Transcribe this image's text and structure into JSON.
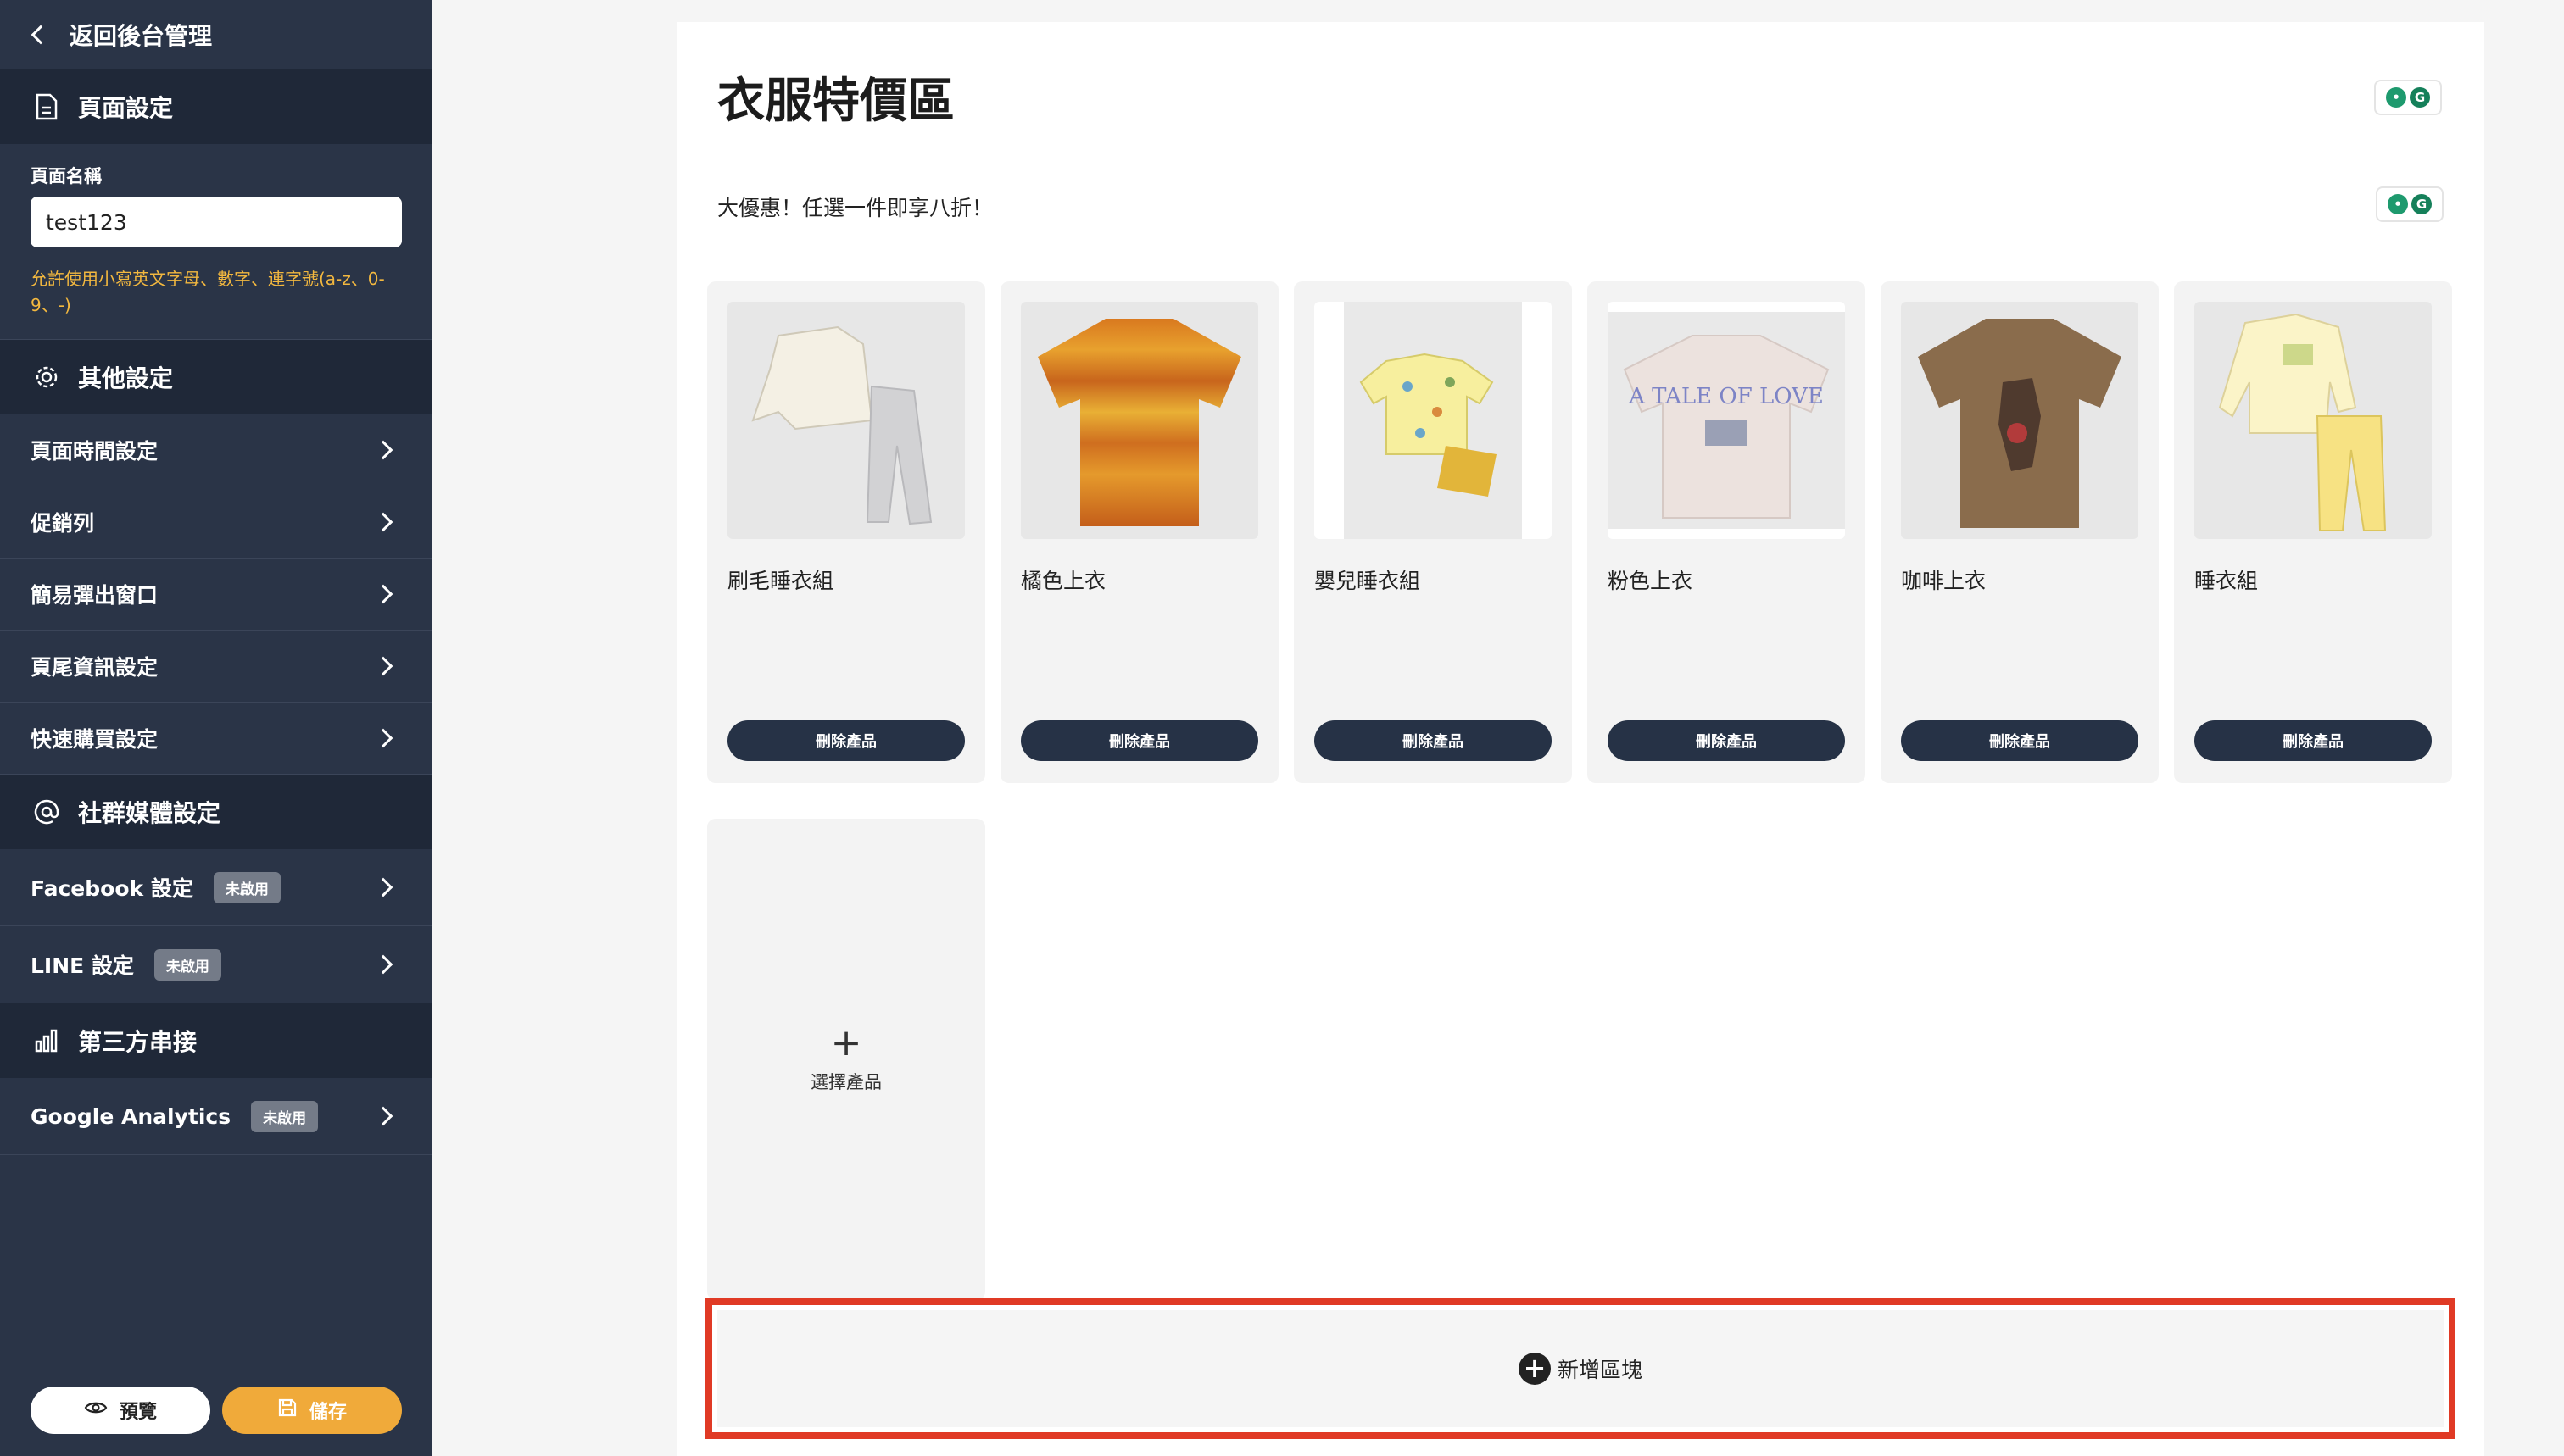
{
  "sidebar": {
    "back_label": "返回後台管理",
    "page_settings": {
      "title": "頁面設定",
      "name_label": "頁面名稱",
      "name_value": "test123",
      "hint": "允許使用小寫英文字母、數字、連字號(a-z、0-9、-)"
    },
    "other_settings": {
      "title": "其他設定",
      "items": [
        {
          "label": "頁面時間設定"
        },
        {
          "label": "促銷列"
        },
        {
          "label": "簡易彈出窗口"
        },
        {
          "label": "頁尾資訊設定"
        },
        {
          "label": "快速購買設定"
        }
      ]
    },
    "social": {
      "title": "社群媒體設定",
      "items": [
        {
          "label": "Facebook 設定",
          "badge": "未啟用"
        },
        {
          "label": "LINE 設定",
          "badge": "未啟用"
        }
      ]
    },
    "third_party": {
      "title": "第三方串接",
      "items": [
        {
          "label": "Google Analytics",
          "badge": "未啟用"
        }
      ]
    },
    "preview_label": "預覽",
    "save_label": "儲存"
  },
  "main": {
    "title": "衣服特價區",
    "subtitle": "大優惠！任選一件即享八折！",
    "products": [
      {
        "name": "刷毛睡衣組",
        "delete_label": "刪除產品"
      },
      {
        "name": "橘色上衣",
        "delete_label": "刪除產品"
      },
      {
        "name": "嬰兒睡衣組",
        "delete_label": "刪除產品"
      },
      {
        "name": "粉色上衣",
        "delete_label": "刪除產品"
      },
      {
        "name": "咖啡上衣",
        "delete_label": "刪除產品"
      },
      {
        "name": "睡衣組",
        "delete_label": "刪除產品"
      }
    ],
    "select_product_label": "選擇產品",
    "add_block_label": "新增區塊"
  },
  "colors": {
    "sidebar_bg": "#2a3447",
    "accent_orange": "#f0aa3a",
    "dark_button": "#263246",
    "highlight_red": "#e03a25"
  }
}
